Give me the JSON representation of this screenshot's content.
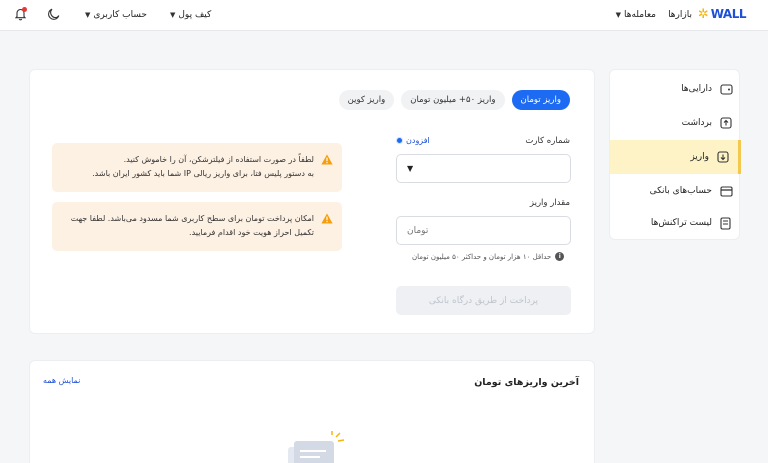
{
  "topbar": {
    "logo_text": "WALL",
    "nav": [
      "بازارها",
      "معامله‌ها"
    ],
    "wallet_label": "کیف پول",
    "account_label": "حساب کاربری"
  },
  "sidebar": {
    "items": [
      {
        "label": "دارایی‌ها",
        "icon": "wallet-icon"
      },
      {
        "label": "برداشت",
        "icon": "upload-icon"
      },
      {
        "label": "واریز",
        "icon": "download-icon"
      },
      {
        "label": "حساب‌های بانکی",
        "icon": "card-icon"
      },
      {
        "label": "لیست تراکنش‌ها",
        "icon": "receipt-icon"
      }
    ],
    "active_index": 2
  },
  "deposit": {
    "tabs": [
      "واریز تومان",
      "واریز ۵۰+ میلیون تومان",
      "واریز کوین"
    ],
    "card_label": "شماره کارت",
    "add_label": "افزودن",
    "amount_label": "مقدار واریز",
    "amount_placeholder": "تومان",
    "hint": "حداقل ۱۰ هزار تومان و حداکثر ۵۰ میلیون تومان",
    "pay_button": "پرداخت از طریق درگاه بانکی",
    "alerts": [
      {
        "lines": [
          "لطفاً در صورت استفاده از فیلترشکن، آن را خاموش کنید.",
          "به دستور پلیس فتا، برای واریز ریالی IP شما باید کشور ایران باشد."
        ]
      },
      {
        "lines": [
          "امکان پرداخت تومان برای سطح کاربری شما مسدود می‌باشد. لطفا جهت",
          "تکمیل احراز هویت خود اقدام فرمایید."
        ]
      }
    ]
  },
  "recent": {
    "title": "آخرین واریزهای تومان",
    "show_all": "نمایش همه"
  },
  "colors": {
    "primary": "#1d6bf3",
    "active_side": "#fdf3c7",
    "alert_bg": "#fdf1e3",
    "warning": "#f59e0b"
  }
}
